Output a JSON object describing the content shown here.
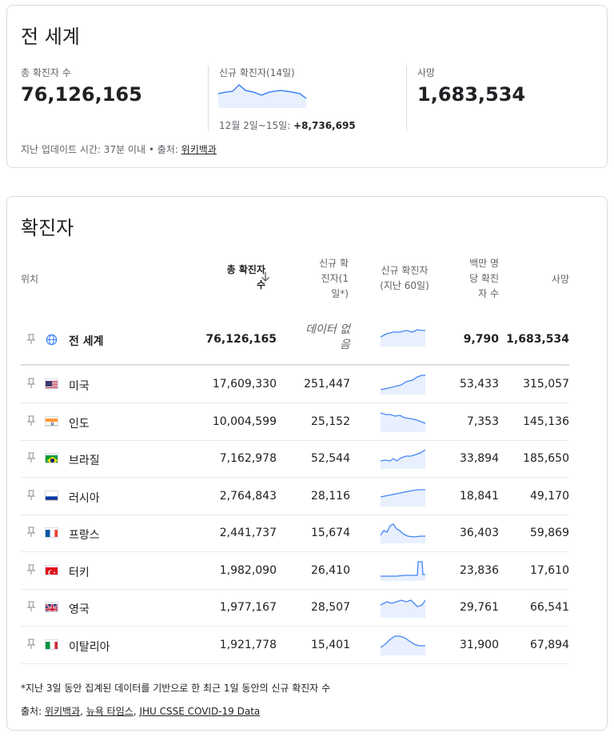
{
  "summary": {
    "title": "전 세계",
    "total_label": "총 확진자 수",
    "total_value": "76,126,165",
    "new_label": "신규 확진자(14일)",
    "new_range": "12월 2일~15일:",
    "new_value": "+8,736,695",
    "deaths_label": "사망",
    "deaths_value": "1,683,534",
    "updated_prefix": "지난 업데이트 시간: 37분 이내 • 출처:",
    "updated_source": "위키백과"
  },
  "cases": {
    "title": "확진자",
    "headers": {
      "location": "위치",
      "total_line1": "총 확진자",
      "total_line2": "수",
      "new_line1": "신규 확",
      "new_line2": "진자(1",
      "new_line3": "일*)",
      "spark_line1": "신규 확진자",
      "spark_line2": "(지난 60일)",
      "permillion_line1": "백만 명",
      "permillion_line2": "당 확진",
      "permillion_line3": "자 수",
      "deaths": "사망"
    },
    "world": {
      "name": "전 세계",
      "total": "76,126,165",
      "new_line1": "데이터 없",
      "new_line2": "음",
      "per_million": "9,790",
      "deaths": "1,683,534"
    },
    "rows": [
      {
        "name": "미국",
        "flag": "us",
        "total": "17,609,330",
        "new": "251,447",
        "per_million": "53,433",
        "deaths": "315,057"
      },
      {
        "name": "인도",
        "flag": "in",
        "total": "10,004,599",
        "new": "25,152",
        "per_million": "7,353",
        "deaths": "145,136"
      },
      {
        "name": "브라질",
        "flag": "br",
        "total": "7,162,978",
        "new": "52,544",
        "per_million": "33,894",
        "deaths": "185,650"
      },
      {
        "name": "러시아",
        "flag": "ru",
        "total": "2,764,843",
        "new": "28,116",
        "per_million": "18,841",
        "deaths": "49,170"
      },
      {
        "name": "프랑스",
        "flag": "fr",
        "total": "2,441,737",
        "new": "15,674",
        "per_million": "36,403",
        "deaths": "59,869"
      },
      {
        "name": "터키",
        "flag": "tr",
        "total": "1,982,090",
        "new": "26,410",
        "per_million": "23,836",
        "deaths": "17,610"
      },
      {
        "name": "영국",
        "flag": "gb",
        "total": "1,977,167",
        "new": "28,507",
        "per_million": "29,761",
        "deaths": "66,541"
      },
      {
        "name": "이탈리아",
        "flag": "it",
        "total": "1,921,778",
        "new": "15,401",
        "per_million": "31,900",
        "deaths": "67,894"
      }
    ],
    "footnote": "*지난 3일 동안 집계된 데이터를 기반으로 한 최근 1일 동안의 신규 확진자 수",
    "sources_prefix": "출처:",
    "sources": [
      "위키백과",
      "뉴욕 타임스",
      "JHU CSSE COVID-19 Data"
    ]
  },
  "colors": {
    "spark": "#4285f4",
    "spark_fill": "#e8f0fe"
  }
}
